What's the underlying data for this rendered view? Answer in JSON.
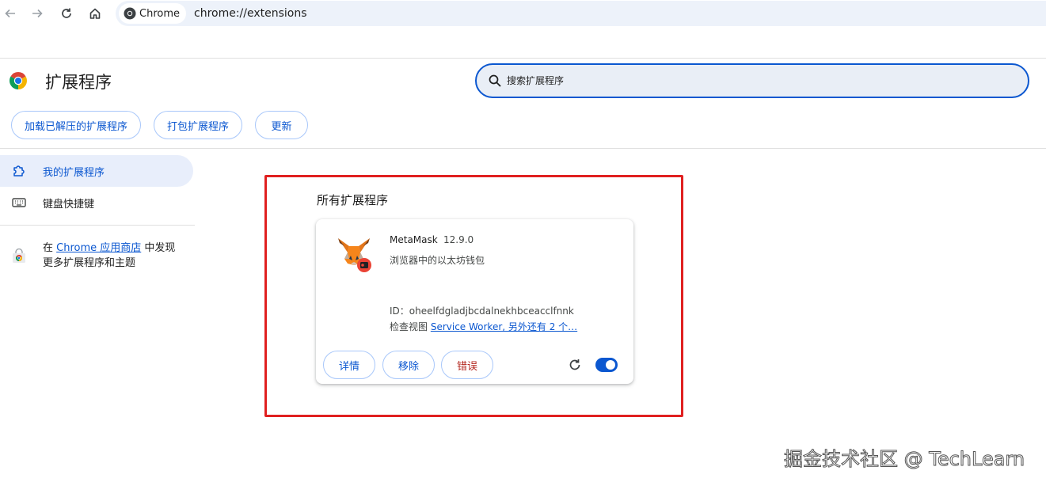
{
  "browser": {
    "site_chip": "Chrome",
    "url": "chrome://extensions"
  },
  "header": {
    "title": "扩展程序",
    "search_placeholder": "搜索扩展程序",
    "buttons": {
      "load_unpacked": "加载已解压的扩展程序",
      "pack": "打包扩展程序",
      "update": "更新"
    }
  },
  "sidebar": {
    "items": [
      {
        "label": "我的扩展程序",
        "icon": "puzzle-icon",
        "active": true
      },
      {
        "label": "键盘快捷键",
        "icon": "keyboard-icon",
        "active": false
      }
    ],
    "store": {
      "prefix": "在 ",
      "link": "Chrome 应用商店",
      "suffix": " 中发现",
      "line2": "更多扩展程序和主题"
    }
  },
  "main": {
    "section_title": "所有扩展程序",
    "extension": {
      "name": "MetaMask",
      "version": "12.9.0",
      "description": "浏览器中的以太坊钱包",
      "id_label": "ID：",
      "id": "oheelfdgladjbcdalnekhbceacclfnnk",
      "views_label": "检查视图 ",
      "views_link": "Service Worker, 另外还有 2 个…",
      "buttons": {
        "details": "详情",
        "remove": "移除",
        "errors": "错误"
      },
      "enabled": true
    }
  },
  "watermark": "掘金技术社区 @ TechLearn",
  "colors": {
    "accent": "#0b57d0",
    "highlight_border": "#e02020",
    "error_text": "#b3261e"
  }
}
